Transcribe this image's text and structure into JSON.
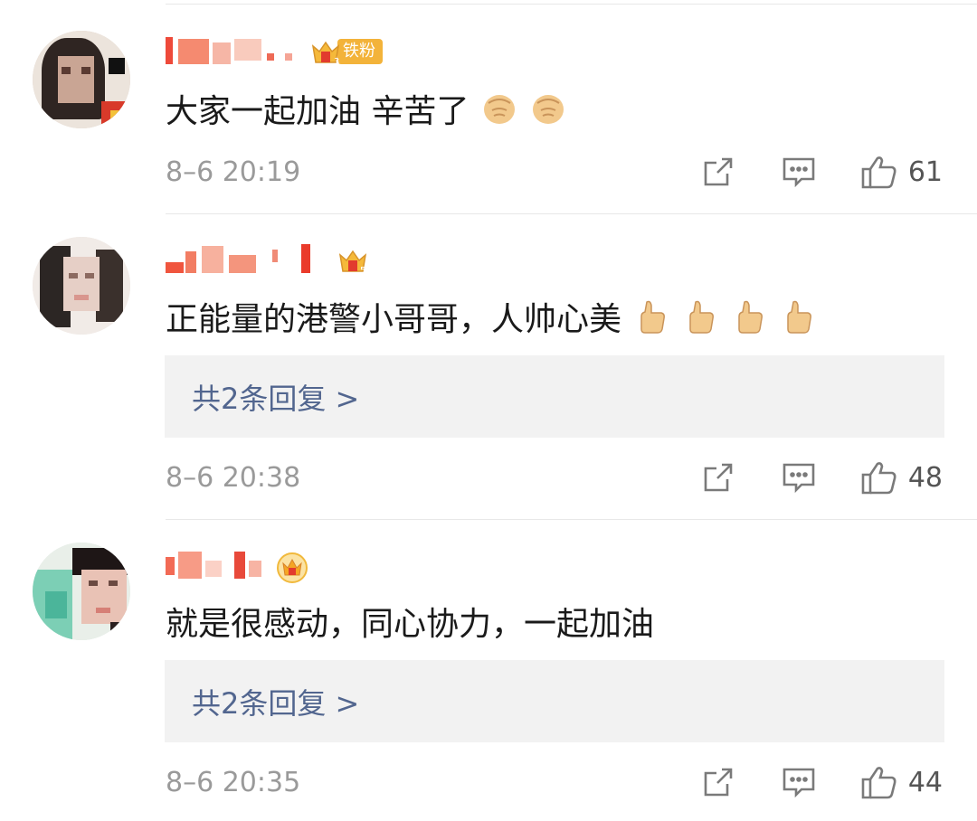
{
  "comments": [
    {
      "badge_text": "铁粉",
      "text": "大家一起加油 辛苦了",
      "emoji": [
        "fist-emoji",
        "fist-emoji"
      ],
      "time": "8–6 20:19",
      "likes": "61"
    },
    {
      "text": "正能量的港警小哥哥，人帅心美",
      "emoji": [
        "thumbs-up-emoji",
        "thumbs-up-emoji",
        "thumbs-up-emoji",
        "thumbs-up-emoji"
      ],
      "replies": "共2条回复 >",
      "time": "8–6 20:38",
      "likes": "48"
    },
    {
      "text": "就是很感动，同心协力，一起加油",
      "replies": "共2条回复 >",
      "time": "8–6 20:35",
      "likes": "44"
    }
  ],
  "icons": {
    "share": "share-icon",
    "comment": "comment-icon",
    "like": "like-icon"
  },
  "colors": {
    "reply_link": "#52668f",
    "badge": "#f3b33a",
    "meta_text": "#9a9a9a"
  }
}
